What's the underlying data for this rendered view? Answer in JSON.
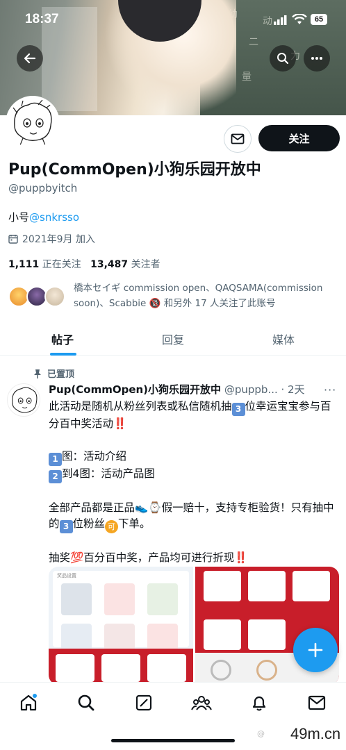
{
  "status_bar": {
    "time": "18:37",
    "battery": "65"
  },
  "profile": {
    "name": "Pup(CommOpen)小狗乐园开放中",
    "handle": "@puppbyitch",
    "bio_prefix": "小号",
    "bio_link": "@snkrsso",
    "joined": "2021年9月 加入",
    "following_count": "1,111",
    "following_label": "正在关注",
    "followers_count": "13,487",
    "followers_label": "关注者",
    "followed_by": "橋本セイギ commission open、QAQSAMA(commission soon)、Scabbie 🔞 和另外 17 人关注了此账号",
    "follow_label": "关注"
  },
  "tabs": [
    {
      "label": "帖子",
      "active": true
    },
    {
      "label": "回复",
      "active": false
    },
    {
      "label": "媒体",
      "active": false
    }
  ],
  "post": {
    "pinned_label": "已置顶",
    "author": "Pup(CommOpen)小狗乐园开放中",
    "meta": "@puppb... · 2天",
    "line1a": "此活动是随机从粉丝列表或私信随机抽",
    "num3": "3",
    "line1b": "位幸运宝宝参与百分百中奖活动",
    "redx": "‼️",
    "item1_num": "1",
    "item1_text": "图：活动介绍",
    "item2_num": "2",
    "item2_text": "到4图：活动产品图",
    "para3a": "全部产品都是正品👟⌚假一赔十，支持专柜验货！只有抽中的",
    "para3b": "位粉丝",
    "ke": "可",
    "para3c": "下单。",
    "para4a": "抽奖💯百分百中奖，产品均可进行折现",
    "media_left_title": "奖品设置"
  },
  "watermark": "49m.cn",
  "colors": {
    "accent": "#1d9bf0",
    "text": "#0f1419",
    "muted": "#536471"
  },
  "icons": [
    "back-arrow-icon",
    "search-icon",
    "more-icon",
    "mail-icon",
    "calendar-icon",
    "pin-icon",
    "plus-icon",
    "home-icon",
    "explore-icon",
    "grok-icon",
    "communities-icon",
    "notifications-icon",
    "messages-icon"
  ]
}
